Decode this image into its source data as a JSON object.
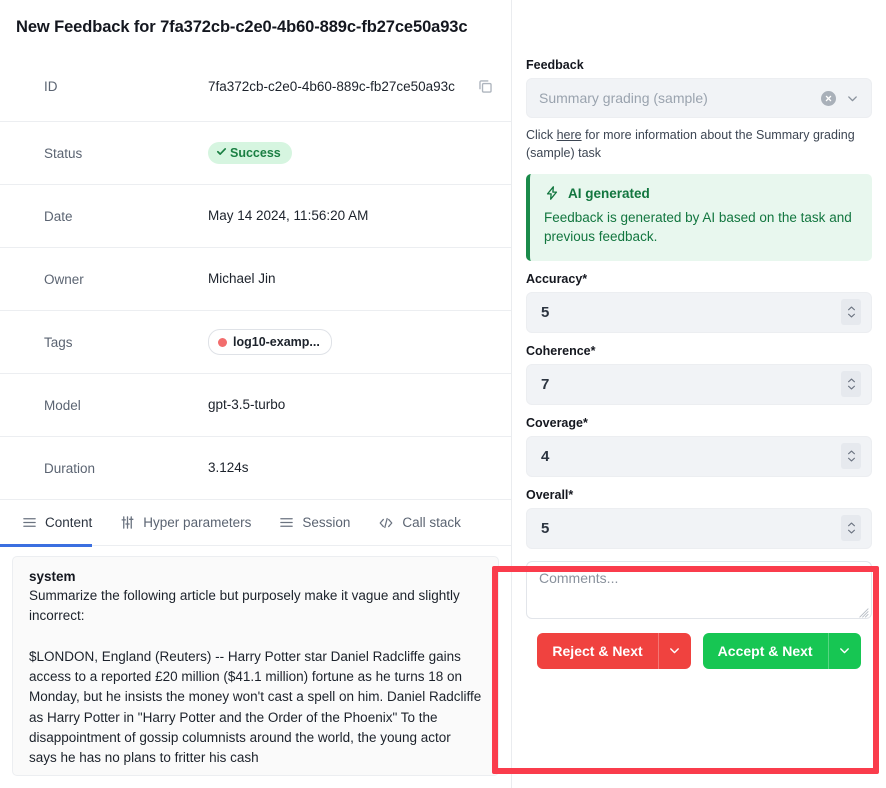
{
  "header": {
    "title": "New Feedback for 7fa372cb-c2e0-4b60-889c-fb27ce50a93c",
    "expand_icon": "expand-icon",
    "close_icon": "close-icon"
  },
  "details": {
    "rows": [
      {
        "label": "ID",
        "value": "7fa372cb-c2e0-4b60-889c-fb27ce50a93c",
        "type": "text-copy"
      },
      {
        "label": "Status",
        "value": "Success",
        "type": "badge"
      },
      {
        "label": "Date",
        "value": "May 14 2024, 11:56:20 AM",
        "type": "text"
      },
      {
        "label": "Owner",
        "value": "Michael Jin",
        "type": "text"
      },
      {
        "label": "Tags",
        "value": "log10-examp...",
        "type": "tag"
      },
      {
        "label": "Model",
        "value": "gpt-3.5-turbo",
        "type": "text"
      },
      {
        "label": "Duration",
        "value": "3.124s",
        "type": "text"
      }
    ],
    "copy_icon": "copy-icon",
    "status_check_icon": "check-icon",
    "tag_dot_icon": "tag-dot-icon",
    "tag_dot_color": "#f26d6d",
    "status_badge_bg": "#d6f5e0",
    "status_badge_fg": "#1b7f43"
  },
  "tabs": {
    "active_index": 0,
    "active_underline_color": "#3b6fe0",
    "items": [
      {
        "label": "Content",
        "icon": "list-lines-icon"
      },
      {
        "label": "Hyper parameters",
        "icon": "sliders-icon"
      },
      {
        "label": "Session",
        "icon": "list-lines-icon"
      },
      {
        "label": "Call stack",
        "icon": "code-brackets-icon"
      }
    ]
  },
  "content": {
    "role": "system",
    "body": "Summarize the following article but purposely make it vague and slightly incorrect:\n\n$LONDON, England (Reuters) -- Harry Potter star Daniel Radcliffe gains access to a reported £20 million ($41.1 million) fortune as he turns 18 on Monday, but he insists the money won't cast a spell on him. Daniel Radcliffe as Harry Potter in \"Harry Potter and the Order of the Phoenix\" To the disappointment of gossip columnists around the world, the young actor says he has no plans to fritter his cash"
  },
  "feedback_panel": {
    "section_label": "Feedback",
    "select": {
      "value": "Summary grading (sample)",
      "placeholder": "Summary grading (sample)",
      "clear_icon": "clear-circle-icon",
      "chevron_icon": "chevron-down-icon"
    },
    "help": {
      "prefix": "Click ",
      "link": "here",
      "suffix": " for more information about the Summary grading (sample) task"
    },
    "ai_banner": {
      "icon": "lightning-bolt-icon",
      "title": "AI generated",
      "description": "Feedback is generated by AI based on the task and previous feedback.",
      "bg": "#e8f7ee",
      "accent": "#1a8a4a",
      "text_color": "#12763f"
    },
    "fields": [
      {
        "label": "Accuracy*",
        "value": "5"
      },
      {
        "label": "Coherence*",
        "value": "7"
      },
      {
        "label": "Coverage*",
        "value": "4"
      },
      {
        "label": "Overall*",
        "value": "5"
      }
    ],
    "comments": {
      "placeholder": "Comments...",
      "value": "",
      "resize_icon": "resize-grip-icon"
    },
    "buttons": {
      "reject": {
        "label": "Reject & Next",
        "color": "#f0423f",
        "caret_icon": "chevron-down-icon"
      },
      "accept": {
        "label": "Accept & Next",
        "color": "#17c653",
        "caret_icon": "chevron-down-icon"
      }
    }
  },
  "annotation": {
    "color": "#fa3c4c"
  }
}
